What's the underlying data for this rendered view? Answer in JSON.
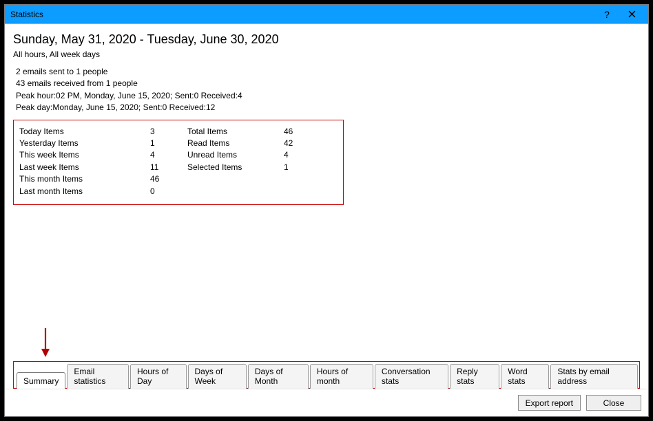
{
  "window": {
    "title": "Statistics"
  },
  "header": {
    "date_range": "Sunday, May 31, 2020 - Tuesday, June 30, 2020",
    "filters": "All hours, All week days"
  },
  "summary": {
    "line1": "2 emails sent to 1 people",
    "line2": "43 emails received from 1 people",
    "line3": "Peak hour:02 PM, Monday, June 15, 2020; Sent:0 Received:4",
    "line4": "Peak day:Monday, June 15, 2020; Sent:0 Received:12"
  },
  "stats": {
    "left": [
      {
        "label": "Today Items",
        "value": "3"
      },
      {
        "label": "Yesterday Items",
        "value": "1"
      },
      {
        "label": "This week Items",
        "value": "4"
      },
      {
        "label": "Last week Items",
        "value": "11"
      },
      {
        "label": "This month Items",
        "value": "46"
      },
      {
        "label": "Last month Items",
        "value": "0"
      }
    ],
    "right": [
      {
        "label": "Total Items",
        "value": "46"
      },
      {
        "label": "Read Items",
        "value": "42"
      },
      {
        "label": "Unread Items",
        "value": "4"
      },
      {
        "label": "Selected Items",
        "value": "1"
      }
    ]
  },
  "tabs": {
    "items": [
      "Summary",
      "Email statistics",
      "Hours of Day",
      "Days of Week",
      "Days of Month",
      "Hours of month",
      "Conversation stats",
      "Reply stats",
      "Word stats",
      "Stats by email address"
    ],
    "active_index": 0
  },
  "footer": {
    "export": "Export report",
    "close": "Close"
  }
}
